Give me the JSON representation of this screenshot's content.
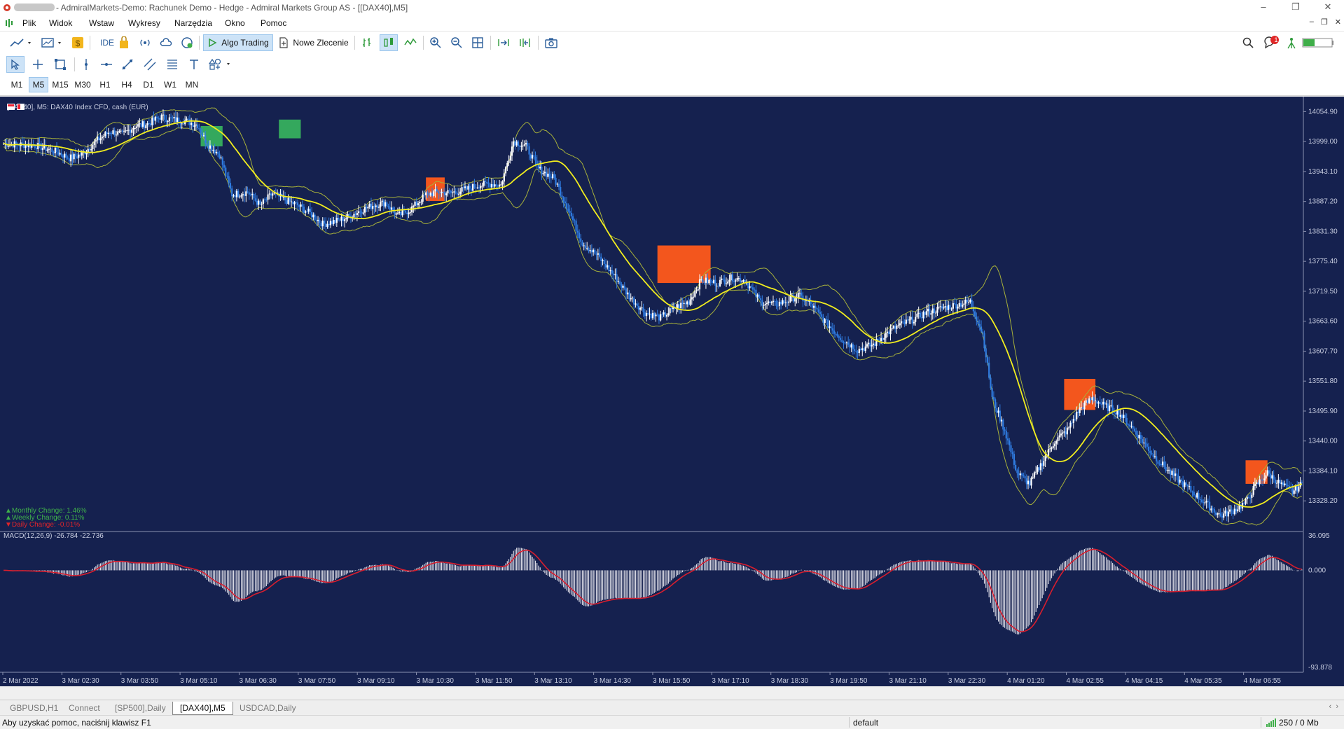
{
  "window": {
    "title": "- AdmiralMarkets-Demo: Rachunek Demo - Hedge - Admiral Markets Group AS - [[DAX40],M5]",
    "controls": [
      "–",
      "❐",
      "✕"
    ]
  },
  "menu": {
    "items": [
      "Plik",
      "Widok",
      "Wstaw",
      "Wykresy",
      "Narzędzia",
      "Okno",
      "Pomoc"
    ],
    "right_controls": [
      "–",
      "❐",
      "✕"
    ]
  },
  "toolbar": {
    "ide_label": "IDE",
    "algo_trading_label": "Algo Trading",
    "new_order_label": "Nowe Zlecenie",
    "notification_count": "1"
  },
  "timeframes": {
    "items": [
      "M1",
      "M5",
      "M15",
      "M30",
      "H1",
      "H4",
      "D1",
      "W1",
      "MN"
    ],
    "selected": "M5"
  },
  "chart": {
    "header": "[DAX40], M5:  DAX40 Index CFD, cash (EUR)",
    "monthly_change": "▲Monthly Change: 1.46%",
    "weekly_change": "▲Weekly Change: 0.11%",
    "daily_change": "▼Daily Change: -0.01%",
    "macd_label": "MACD(12,26,9) -26.784 -22.736",
    "colors": {
      "background": "#15214f",
      "bull_candle": "#ffffff",
      "bear_candle": "#2f7be0",
      "ma": "#f2ee1e",
      "bands": "#a8b23a",
      "signal": "#d81e2e",
      "histogram": "#dcdce6",
      "box_green": "#36b05e",
      "box_orange": "#ff5a1a"
    }
  },
  "chart_data": {
    "type": "candlestick",
    "price_axis": {
      "ticks": [
        "14054.90",
        "13999.00",
        "13943.10",
        "13887.20",
        "13831.30",
        "13775.40",
        "13719.50",
        "13663.60",
        "13607.70",
        "13551.80",
        "13495.90",
        "13440.00",
        "13384.10",
        "13328.20"
      ],
      "range": [
        13272.3,
        14082.85
      ],
      "current_price": "13384.10"
    },
    "time_axis": {
      "ticks": [
        "2 Mar 2022",
        "3 Mar 02:30",
        "3 Mar 03:50",
        "3 Mar 05:10",
        "3 Mar 06:30",
        "3 Mar 07:50",
        "3 Mar 09:10",
        "3 Mar 10:30",
        "3 Mar 11:50",
        "3 Mar 13:10",
        "3 Mar 14:30",
        "3 Mar 15:50",
        "3 Mar 17:10",
        "3 Mar 18:30",
        "3 Mar 19:50",
        "3 Mar 21:10",
        "3 Mar 22:30",
        "4 Mar 01:20",
        "4 Mar 02:55",
        "4 Mar 04:15",
        "4 Mar 05:35",
        "4 Mar 06:55"
      ]
    },
    "close_path": [
      [
        0,
        13995
      ],
      [
        20,
        13992
      ],
      [
        34,
        13980
      ],
      [
        42,
        13968
      ],
      [
        50,
        13975
      ],
      [
        60,
        14002
      ],
      [
        68,
        14018
      ],
      [
        76,
        14012
      ],
      [
        84,
        14028
      ],
      [
        92,
        14032
      ],
      [
        100,
        14045
      ],
      [
        108,
        14040
      ],
      [
        116,
        14038
      ],
      [
        124,
        14030
      ],
      [
        130,
        13995
      ],
      [
        138,
        13975
      ],
      [
        146,
        13900
      ],
      [
        156,
        13905
      ],
      [
        164,
        13880
      ],
      [
        172,
        13902
      ],
      [
        180,
        13890
      ],
      [
        188,
        13880
      ],
      [
        196,
        13865
      ],
      [
        204,
        13845
      ],
      [
        212,
        13850
      ],
      [
        220,
        13858
      ],
      [
        228,
        13870
      ],
      [
        236,
        13880
      ],
      [
        244,
        13885
      ],
      [
        252,
        13860
      ],
      [
        260,
        13872
      ],
      [
        270,
        13900
      ],
      [
        278,
        13905
      ],
      [
        286,
        13903
      ],
      [
        296,
        13910
      ],
      [
        304,
        13918
      ],
      [
        312,
        13920
      ],
      [
        318,
        13918
      ],
      [
        326,
        14000
      ],
      [
        334,
        13990
      ],
      [
        342,
        13948
      ],
      [
        352,
        13930
      ],
      [
        360,
        13880
      ],
      [
        370,
        13810
      ],
      [
        380,
        13785
      ],
      [
        390,
        13750
      ],
      [
        400,
        13710
      ],
      [
        410,
        13680
      ],
      [
        420,
        13670
      ],
      [
        430,
        13690
      ],
      [
        438,
        13700
      ],
      [
        446,
        13740
      ],
      [
        456,
        13735
      ],
      [
        466,
        13745
      ],
      [
        474,
        13740
      ],
      [
        484,
        13700
      ],
      [
        492,
        13695
      ],
      [
        500,
        13700
      ],
      [
        508,
        13712
      ],
      [
        516,
        13695
      ],
      [
        526,
        13660
      ],
      [
        536,
        13630
      ],
      [
        546,
        13610
      ],
      [
        556,
        13620
      ],
      [
        564,
        13640
      ],
      [
        572,
        13655
      ],
      [
        580,
        13665
      ],
      [
        590,
        13680
      ],
      [
        600,
        13688
      ],
      [
        610,
        13695
      ],
      [
        618,
        13700
      ],
      [
        626,
        13640
      ],
      [
        632,
        13520
      ],
      [
        640,
        13460
      ],
      [
        648,
        13380
      ],
      [
        656,
        13360
      ],
      [
        664,
        13400
      ],
      [
        672,
        13440
      ],
      [
        680,
        13460
      ],
      [
        688,
        13500
      ],
      [
        696,
        13520
      ],
      [
        704,
        13505
      ],
      [
        712,
        13495
      ],
      [
        720,
        13470
      ],
      [
        728,
        13440
      ],
      [
        736,
        13410
      ],
      [
        746,
        13380
      ],
      [
        754,
        13360
      ],
      [
        762,
        13340
      ],
      [
        770,
        13320
      ],
      [
        778,
        13300
      ],
      [
        786,
        13310
      ],
      [
        794,
        13325
      ],
      [
        800,
        13355
      ],
      [
        808,
        13380
      ],
      [
        816,
        13360
      ],
      [
        824,
        13345
      ],
      [
        830,
        13360
      ]
    ],
    "macd_axis": {
      "ticks": [
        "36.095",
        "0.000",
        "-93.878"
      ],
      "range": [
        -93.878,
        36.095
      ]
    }
  }
}
